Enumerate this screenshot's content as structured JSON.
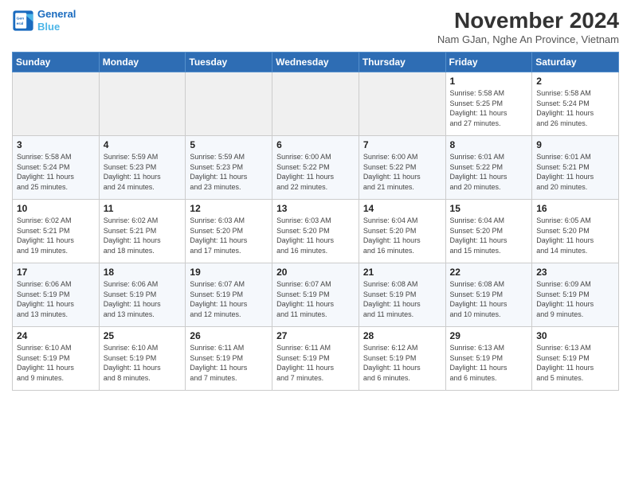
{
  "header": {
    "logo_line1": "General",
    "logo_line2": "Blue",
    "month": "November 2024",
    "location": "Nam GJan, Nghe An Province, Vietnam"
  },
  "days_of_week": [
    "Sunday",
    "Monday",
    "Tuesday",
    "Wednesday",
    "Thursday",
    "Friday",
    "Saturday"
  ],
  "weeks": [
    [
      {
        "day": "",
        "info": ""
      },
      {
        "day": "",
        "info": ""
      },
      {
        "day": "",
        "info": ""
      },
      {
        "day": "",
        "info": ""
      },
      {
        "day": "",
        "info": ""
      },
      {
        "day": "1",
        "info": "Sunrise: 5:58 AM\nSunset: 5:25 PM\nDaylight: 11 hours\nand 27 minutes."
      },
      {
        "day": "2",
        "info": "Sunrise: 5:58 AM\nSunset: 5:24 PM\nDaylight: 11 hours\nand 26 minutes."
      }
    ],
    [
      {
        "day": "3",
        "info": "Sunrise: 5:58 AM\nSunset: 5:24 PM\nDaylight: 11 hours\nand 25 minutes."
      },
      {
        "day": "4",
        "info": "Sunrise: 5:59 AM\nSunset: 5:23 PM\nDaylight: 11 hours\nand 24 minutes."
      },
      {
        "day": "5",
        "info": "Sunrise: 5:59 AM\nSunset: 5:23 PM\nDaylight: 11 hours\nand 23 minutes."
      },
      {
        "day": "6",
        "info": "Sunrise: 6:00 AM\nSunset: 5:22 PM\nDaylight: 11 hours\nand 22 minutes."
      },
      {
        "day": "7",
        "info": "Sunrise: 6:00 AM\nSunset: 5:22 PM\nDaylight: 11 hours\nand 21 minutes."
      },
      {
        "day": "8",
        "info": "Sunrise: 6:01 AM\nSunset: 5:22 PM\nDaylight: 11 hours\nand 20 minutes."
      },
      {
        "day": "9",
        "info": "Sunrise: 6:01 AM\nSunset: 5:21 PM\nDaylight: 11 hours\nand 20 minutes."
      }
    ],
    [
      {
        "day": "10",
        "info": "Sunrise: 6:02 AM\nSunset: 5:21 PM\nDaylight: 11 hours\nand 19 minutes."
      },
      {
        "day": "11",
        "info": "Sunrise: 6:02 AM\nSunset: 5:21 PM\nDaylight: 11 hours\nand 18 minutes."
      },
      {
        "day": "12",
        "info": "Sunrise: 6:03 AM\nSunset: 5:20 PM\nDaylight: 11 hours\nand 17 minutes."
      },
      {
        "day": "13",
        "info": "Sunrise: 6:03 AM\nSunset: 5:20 PM\nDaylight: 11 hours\nand 16 minutes."
      },
      {
        "day": "14",
        "info": "Sunrise: 6:04 AM\nSunset: 5:20 PM\nDaylight: 11 hours\nand 16 minutes."
      },
      {
        "day": "15",
        "info": "Sunrise: 6:04 AM\nSunset: 5:20 PM\nDaylight: 11 hours\nand 15 minutes."
      },
      {
        "day": "16",
        "info": "Sunrise: 6:05 AM\nSunset: 5:20 PM\nDaylight: 11 hours\nand 14 minutes."
      }
    ],
    [
      {
        "day": "17",
        "info": "Sunrise: 6:06 AM\nSunset: 5:19 PM\nDaylight: 11 hours\nand 13 minutes."
      },
      {
        "day": "18",
        "info": "Sunrise: 6:06 AM\nSunset: 5:19 PM\nDaylight: 11 hours\nand 13 minutes."
      },
      {
        "day": "19",
        "info": "Sunrise: 6:07 AM\nSunset: 5:19 PM\nDaylight: 11 hours\nand 12 minutes."
      },
      {
        "day": "20",
        "info": "Sunrise: 6:07 AM\nSunset: 5:19 PM\nDaylight: 11 hours\nand 11 minutes."
      },
      {
        "day": "21",
        "info": "Sunrise: 6:08 AM\nSunset: 5:19 PM\nDaylight: 11 hours\nand 11 minutes."
      },
      {
        "day": "22",
        "info": "Sunrise: 6:08 AM\nSunset: 5:19 PM\nDaylight: 11 hours\nand 10 minutes."
      },
      {
        "day": "23",
        "info": "Sunrise: 6:09 AM\nSunset: 5:19 PM\nDaylight: 11 hours\nand 9 minutes."
      }
    ],
    [
      {
        "day": "24",
        "info": "Sunrise: 6:10 AM\nSunset: 5:19 PM\nDaylight: 11 hours\nand 9 minutes."
      },
      {
        "day": "25",
        "info": "Sunrise: 6:10 AM\nSunset: 5:19 PM\nDaylight: 11 hours\nand 8 minutes."
      },
      {
        "day": "26",
        "info": "Sunrise: 6:11 AM\nSunset: 5:19 PM\nDaylight: 11 hours\nand 7 minutes."
      },
      {
        "day": "27",
        "info": "Sunrise: 6:11 AM\nSunset: 5:19 PM\nDaylight: 11 hours\nand 7 minutes."
      },
      {
        "day": "28",
        "info": "Sunrise: 6:12 AM\nSunset: 5:19 PM\nDaylight: 11 hours\nand 6 minutes."
      },
      {
        "day": "29",
        "info": "Sunrise: 6:13 AM\nSunset: 5:19 PM\nDaylight: 11 hours\nand 6 minutes."
      },
      {
        "day": "30",
        "info": "Sunrise: 6:13 AM\nSunset: 5:19 PM\nDaylight: 11 hours\nand 5 minutes."
      }
    ]
  ]
}
